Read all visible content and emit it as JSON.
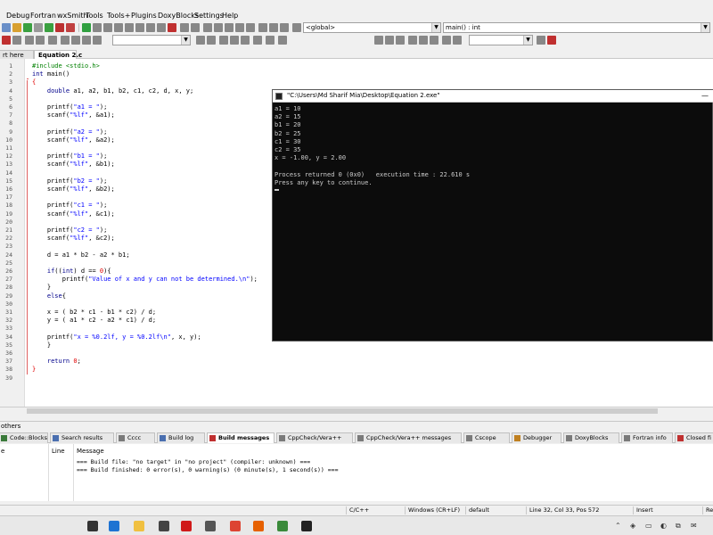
{
  "menu": [
    "Debug",
    "Fortran",
    "wxSmith",
    "Tools",
    "Tools+",
    "Plugins",
    "DoxyBlocks",
    "Settings",
    "Help"
  ],
  "toolbar": {
    "scope_combo": "<global>",
    "function_combo": "main() : int"
  },
  "file_tabs": [
    {
      "label": "rt here",
      "active": false
    },
    {
      "label": "Equation 2.c",
      "active": true
    }
  ],
  "editor": {
    "lines": [
      {
        "n": "1",
        "html": "<span class='pp'>#include &lt;stdio.h&gt;</span>"
      },
      {
        "n": "2",
        "html": "<span class='kw'>int</span> main()"
      },
      {
        "n": "3",
        "html": "<span class='op'>{</span>"
      },
      {
        "n": "4",
        "html": "    <span class='kw'>double</span> a1, a2, b1, b2, c1, c2, d, x, y;"
      },
      {
        "n": "5",
        "html": ""
      },
      {
        "n": "6",
        "html": "    printf(<span class='str'>\"a1 = \"</span>);"
      },
      {
        "n": "7",
        "html": "    scanf(<span class='str'>\"%lf\"</span>, &amp;a1);"
      },
      {
        "n": "8",
        "html": ""
      },
      {
        "n": "9",
        "html": "    printf(<span class='str'>\"a2 = \"</span>);"
      },
      {
        "n": "10",
        "html": "    scanf(<span class='str'>\"%lf\"</span>, &amp;a2);"
      },
      {
        "n": "11",
        "html": ""
      },
      {
        "n": "12",
        "html": "    printf(<span class='str'>\"b1 = \"</span>);"
      },
      {
        "n": "13",
        "html": "    scanf(<span class='str'>\"%lf\"</span>, &amp;b1);"
      },
      {
        "n": "14",
        "html": ""
      },
      {
        "n": "15",
        "html": "    printf(<span class='str'>\"b2 = \"</span>);"
      },
      {
        "n": "16",
        "html": "    scanf(<span class='str'>\"%lf\"</span>, &amp;b2);"
      },
      {
        "n": "17",
        "html": ""
      },
      {
        "n": "18",
        "html": "    printf(<span class='str'>\"c1 = \"</span>);"
      },
      {
        "n": "19",
        "html": "    scanf(<span class='str'>\"%lf\"</span>, &amp;c1);"
      },
      {
        "n": "20",
        "html": ""
      },
      {
        "n": "21",
        "html": "    printf(<span class='str'>\"c2 = \"</span>);"
      },
      {
        "n": "22",
        "html": "    scanf(<span class='str'>\"%lf\"</span>, &amp;c2);"
      },
      {
        "n": "23",
        "html": ""
      },
      {
        "n": "24",
        "html": "    d = a1 * b2 - a2 * b1;"
      },
      {
        "n": "25",
        "html": ""
      },
      {
        "n": "26",
        "html": "    <span class='kw'>if</span>((<span class='kw'>int</span>) d == <span class='num'>0</span>){"
      },
      {
        "n": "27",
        "html": "        printf(<span class='str'>\"Value of x and y can not be determined.\\n\"</span>);"
      },
      {
        "n": "28",
        "html": "    }"
      },
      {
        "n": "29",
        "html": "    <span class='kw'>else</span>{"
      },
      {
        "n": "30",
        "html": ""
      },
      {
        "n": "31",
        "html": "    x = ( b2 * c1 - b1 * c2) / d;"
      },
      {
        "n": "32",
        "html": "    y = ( a1 * c2 - a2 * c1) / d;"
      },
      {
        "n": "33",
        "html": ""
      },
      {
        "n": "34",
        "html": "    printf(<span class='str'>\"x = %0.2lf, y = %0.2lf\\n\"</span>, x, y);"
      },
      {
        "n": "35",
        "html": "    }"
      },
      {
        "n": "36",
        "html": ""
      },
      {
        "n": "37",
        "html": "    <span class='kw'>return</span> <span class='num'>0</span>;"
      },
      {
        "n": "38",
        "html": "<span class='op'>}</span>"
      },
      {
        "n": "39",
        "html": ""
      }
    ]
  },
  "console": {
    "title": "\"C:\\Users\\Md Sharif Mia\\Desktop\\Equation 2.exe\"",
    "minimize": "—",
    "output": [
      "a1 = 10",
      "a2 = 15",
      "b1 = 20",
      "b2 = 25",
      "c1 = 30",
      "c2 = 35",
      "x = -1.00, y = 2.00",
      "",
      "Process returned 0 (0x0)   execution time : 22.610 s",
      "Press any key to continue."
    ]
  },
  "logs_panel": {
    "title": "others",
    "tabs": [
      {
        "label": "Code::Blocks",
        "active": false,
        "color": "#3a7a3a"
      },
      {
        "label": "Search results",
        "active": false,
        "color": "#4a6fb0"
      },
      {
        "label": "Cccc",
        "active": false,
        "color": "#7a7a7a"
      },
      {
        "label": "Build log",
        "active": false,
        "color": "#4a6fb0"
      },
      {
        "label": "Build messages",
        "active": true,
        "color": "#c03030"
      },
      {
        "label": "CppCheck/Vera++",
        "active": false,
        "color": "#7a7a7a"
      },
      {
        "label": "CppCheck/Vera++ messages",
        "active": false,
        "color": "#7a7a7a"
      },
      {
        "label": "Cscope",
        "active": false,
        "color": "#7a7a7a"
      },
      {
        "label": "Debugger",
        "active": false,
        "color": "#c08020"
      },
      {
        "label": "DoxyBlocks",
        "active": false,
        "color": "#7a7a7a"
      },
      {
        "label": "Fortran info",
        "active": false,
        "color": "#7a7a7a"
      },
      {
        "label": "Closed fi",
        "active": false,
        "color": "#c03030"
      }
    ],
    "columns": [
      "e",
      "Line",
      "Message"
    ],
    "messages": [
      "=== Build file: \"no target\" in \"no project\" (compiler: unknown) ===",
      "=== Build finished: 0 error(s), 0 warning(s) (0 minute(s), 1 second(s)) ==="
    ]
  },
  "statusbar": [
    "C/C++",
    "Windows (CR+LF)",
    "default",
    "Line 32, Col 33, Pos 572",
    "Insert",
    "Re"
  ],
  "taskbar_icons": [
    {
      "name": "task-view-icon",
      "color": "#333333"
    },
    {
      "name": "edge-icon",
      "color": "#1e73d2"
    },
    {
      "name": "file-explorer-icon",
      "color": "#f0c040"
    },
    {
      "name": "store-icon",
      "color": "#444444"
    },
    {
      "name": "opera-icon",
      "color": "#d01a1a"
    },
    {
      "name": "app-icon",
      "color": "#555555"
    },
    {
      "name": "chrome-icon",
      "color": "#dd4433"
    },
    {
      "name": "firefox-icon",
      "color": "#e66000"
    },
    {
      "name": "codeblocks-icon",
      "color": "#3a8a3a"
    },
    {
      "name": "console-icon",
      "color": "#222222"
    }
  ]
}
